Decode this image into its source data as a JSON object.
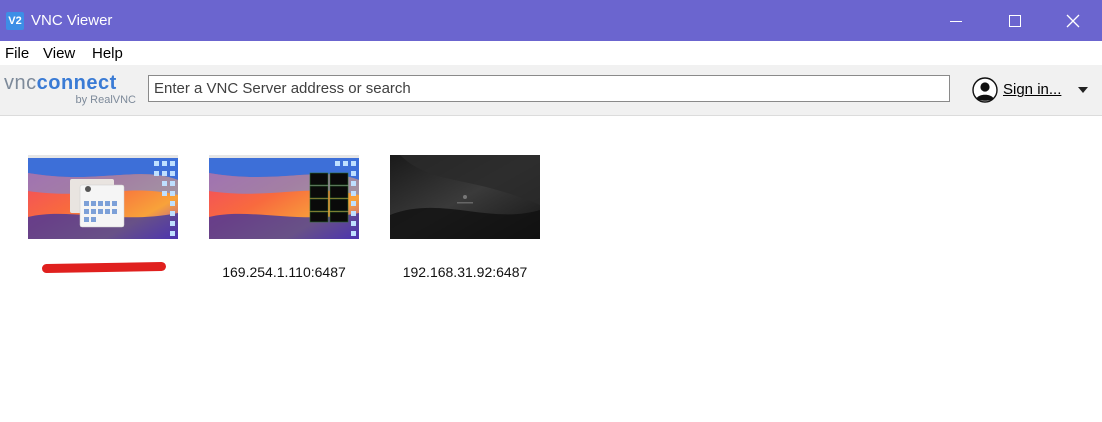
{
  "window": {
    "icon_text": "V2",
    "title": "VNC Viewer"
  },
  "menu": {
    "items": [
      "File",
      "View",
      "Help"
    ]
  },
  "toolbar": {
    "logo_vnc": "vnc",
    "logo_connect": "connect",
    "logo_sub": "by RealVNC",
    "search_placeholder": "Enter a VNC Server address or search",
    "signin_label": "Sign in..."
  },
  "connections": [
    {
      "label": "",
      "thumbnail": "macos-desktop-with-open-window"
    },
    {
      "label": "169.254.1.110:6487",
      "thumbnail": "macos-desktop-with-black-windows"
    },
    {
      "label": "192.168.31.92:6487",
      "thumbnail": "dark-desktop"
    }
  ],
  "colors": {
    "titlebar": "#6b65cf",
    "toolbar": "#f1f1f1",
    "accent": "#3a7bd5",
    "redaction": "#e0201e"
  }
}
